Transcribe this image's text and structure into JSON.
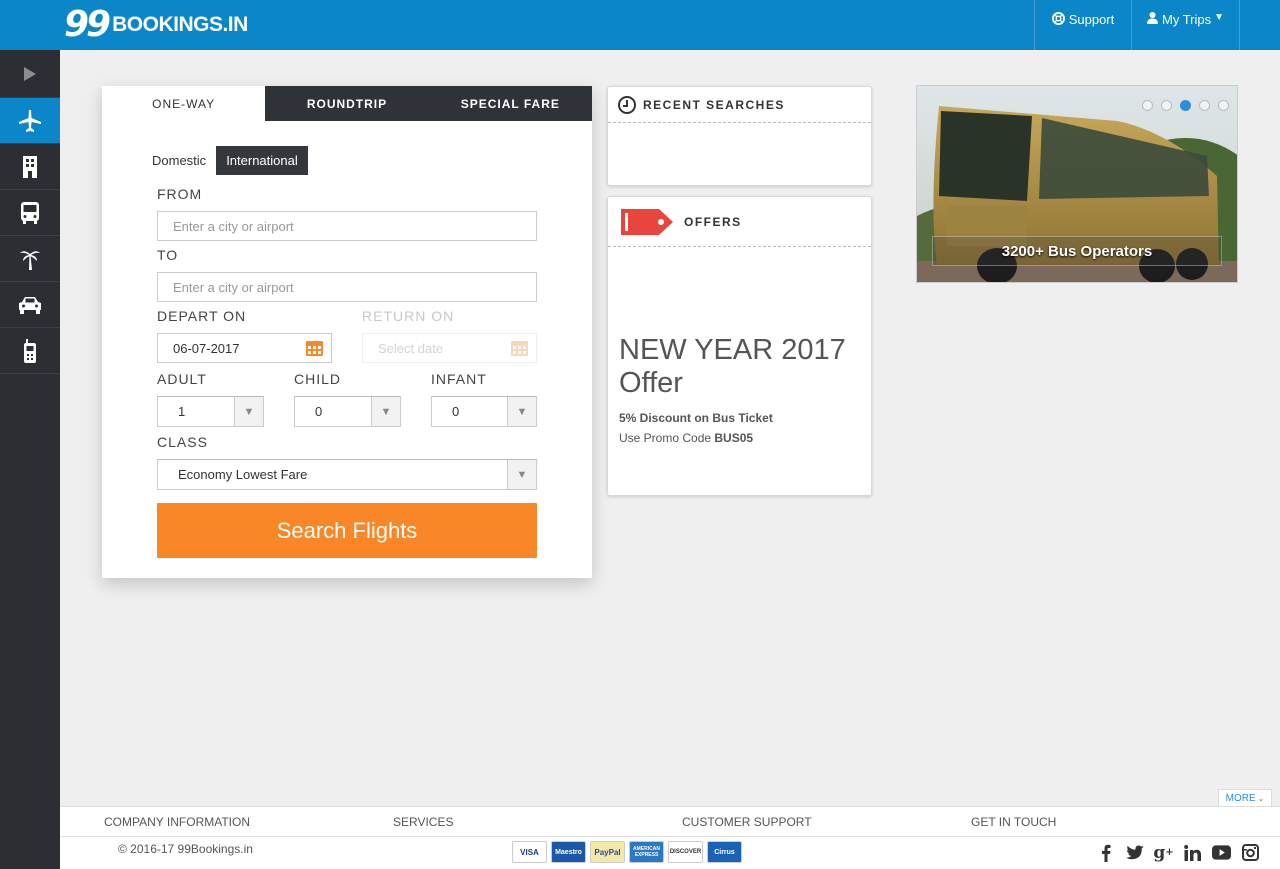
{
  "header": {
    "logo_number": "99",
    "logo_text": "BOOKINGS.IN",
    "support_label": "Support",
    "trips_label": "My Trips"
  },
  "sidebar": {
    "items": [
      {
        "icon": "play-arrow-icon"
      },
      {
        "icon": "airplane-icon",
        "active": true
      },
      {
        "icon": "hotel-icon"
      },
      {
        "icon": "bus-icon"
      },
      {
        "icon": "palm-tree-icon"
      },
      {
        "icon": "car-icon"
      },
      {
        "icon": "mobile-recharge-icon"
      }
    ]
  },
  "search": {
    "tabs": [
      "ONE-WAY",
      "ROUNDTRIP",
      "SPECIAL FARE"
    ],
    "subtabs": [
      "Domestic",
      "International"
    ],
    "from_label": "FROM",
    "from_placeholder": "Enter a city or airport",
    "to_label": "TO",
    "to_placeholder": "Enter a city or airport",
    "depart_label": "DEPART ON",
    "depart_value": "06-07-2017",
    "return_label": "RETURN ON",
    "return_placeholder": "Select date",
    "adult_label": "ADULT",
    "adult_value": "1",
    "child_label": "CHILD",
    "child_value": "0",
    "infant_label": "INFANT",
    "infant_value": "0",
    "class_label": "CLASS",
    "class_value": "Economy Lowest Fare",
    "submit_label": "Search Flights"
  },
  "recent": {
    "title": "RECENT SEARCHES"
  },
  "offers": {
    "title": "OFFERS",
    "headline": "NEW YEAR 2017 Offer",
    "discount": "5% Discount on Bus Ticket",
    "promo_prefix": "Use Promo Code ",
    "promo_code": "BUS05"
  },
  "banner": {
    "caption": "3200+ Bus Operators",
    "slide_count": 5,
    "active_slide": 3
  },
  "footer": {
    "more_label": "MORE",
    "sections": [
      "COMPANY INFORMATION",
      "SERVICES",
      "CUSTOMER SUPPORT",
      "GET IN TOUCH"
    ],
    "copyright": "© 2016-17 99Bookings.in",
    "payment_cards": [
      "VISA",
      "Maestro",
      "PayPal",
      "AMERICAN EXPRESS",
      "DISCOVER",
      "Cirrus"
    ],
    "social": [
      "facebook-icon",
      "twitter-icon",
      "google-plus-icon",
      "linkedin-icon",
      "youtube-icon",
      "instagram-icon"
    ]
  },
  "colors": {
    "brand_blue": "#0a86c9",
    "sidebar_dark": "#2b2f33",
    "accent_orange": "#f98727",
    "offer_tag_red": "#e8453c"
  }
}
